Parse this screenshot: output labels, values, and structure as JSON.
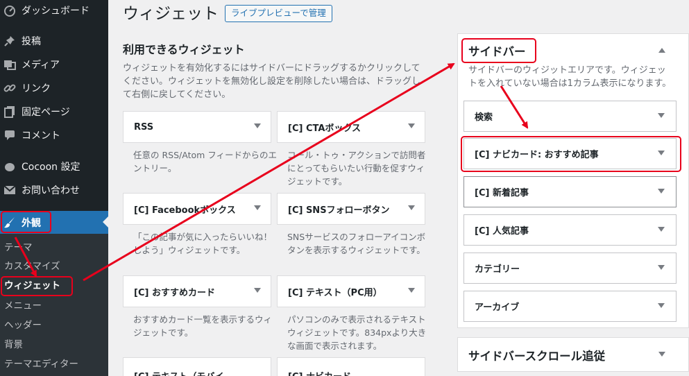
{
  "menu": {
    "items": [
      {
        "label": "ダッシュボード",
        "icon": "dashboard-icon"
      },
      {
        "label": "投稿",
        "icon": "pin-icon"
      },
      {
        "label": "メディア",
        "icon": "media-icon"
      },
      {
        "label": "リンク",
        "icon": "link-icon"
      },
      {
        "label": "固定ページ",
        "icon": "page-icon"
      },
      {
        "label": "コメント",
        "icon": "comment-icon"
      },
      {
        "label": "Cocoon 設定",
        "icon": "cocoon-icon"
      },
      {
        "label": "お問い合わせ",
        "icon": "mail-icon"
      },
      {
        "label": "外観",
        "icon": "brush-icon"
      }
    ],
    "submenu": [
      "テーマ",
      "カスタマイズ",
      "ウィジェット",
      "メニュー",
      "ヘッダー",
      "背景",
      "テーマエディター"
    ]
  },
  "header": {
    "title": "ウィジェット",
    "preview_button": "ライブプレビューで管理"
  },
  "available": {
    "title": "利用できるウィジェット",
    "description": "ウィジェットを有効化するにはサイドバーにドラッグするかクリックしてください。ウィジェットを無効化し設定を削除したい場合は、ドラッグして右側に戻してください。",
    "widgets": [
      {
        "name": "RSS",
        "desc": "任意の RSS/Atom フィードからのエントリー。"
      },
      {
        "name": "[C] CTAボックス",
        "desc": "コール・トゥ・アクションで訪問者にとってもらいたい行動を促すウィジェットです。"
      },
      {
        "name": "[C] Facebookボックス",
        "desc": "「この記事が気に入ったらいいね！しよう」ウィジェットです。"
      },
      {
        "name": "[C] SNSフォローボタン",
        "desc": "SNSサービスのフォローアイコンボタンを表示するウィジェットです。"
      },
      {
        "name": "[C] おすすめカード",
        "desc": "おすすめカード一覧を表示するウィジェットです。"
      },
      {
        "name": "[C] テキスト（PC用）",
        "desc": "パソコンのみで表示されるテキストウィジェットです。834pxより大きな画面で表示されます。"
      },
      {
        "name": "[C] テキスト（モバイ",
        "desc": ""
      },
      {
        "name": "[C] ナビカード",
        "desc": ""
      }
    ]
  },
  "sidebar_area": {
    "title": "サイドバー",
    "description": "サイドバーのウィジットエリアです。ウィジェットを入れていない場合は1カラム表示になります。",
    "widgets": [
      "検索",
      "[C] ナビカード: おすすめ記事",
      "[C] 新着記事",
      "[C] 人気記事",
      "カテゴリー",
      "アーカイブ"
    ]
  },
  "scroll_area": {
    "title": "サイドバースクロール追従"
  },
  "colors": {
    "admin_bg": "#1d2327",
    "accent": "#2271b1",
    "annotation_red": "#e8001c"
  }
}
